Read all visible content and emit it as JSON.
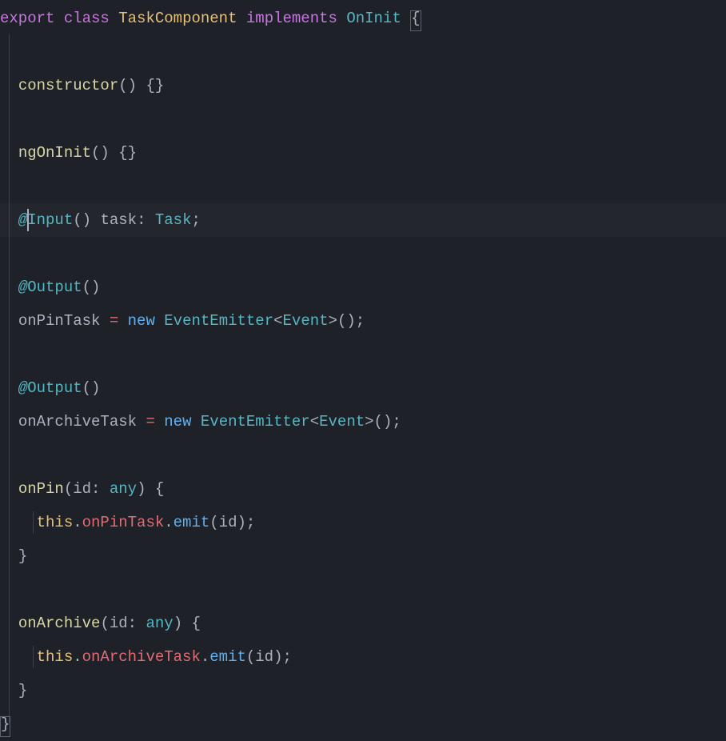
{
  "code": {
    "l1": {
      "export": "export",
      "class": "class",
      "className": "TaskComponent",
      "implements": "implements",
      "iface": "OnInit",
      "brace": "{"
    },
    "l3": {
      "ctor": "constructor",
      "parens": "()",
      "braces": "{}"
    },
    "l5": {
      "name": "ngOnInit",
      "parens": "()",
      "braces": "{}"
    },
    "l7": {
      "at": "@",
      "deco": "Input",
      "parens": "()",
      "prop": "task",
      "colon": ":",
      "type": "Task",
      "semi": ";"
    },
    "l9": {
      "at": "@",
      "deco": "Output",
      "parens": "()"
    },
    "l10": {
      "prop": "onPinTask",
      "eq": "=",
      "new": "new",
      "ctor": "EventEmitter",
      "lt": "<",
      "gen": "Event",
      "gt": ">",
      "parens": "()",
      "semi": ";"
    },
    "l12": {
      "at": "@",
      "deco": "Output",
      "parens": "()"
    },
    "l13": {
      "prop": "onArchiveTask",
      "eq": "=",
      "new": "new",
      "ctor": "EventEmitter",
      "lt": "<",
      "gen": "Event",
      "gt": ">",
      "parens": "()",
      "semi": ";"
    },
    "l15": {
      "name": "onPin",
      "lp": "(",
      "param": "id",
      "colon": ":",
      "type": "any",
      "rp": ")",
      "brace": "{"
    },
    "l16": {
      "this": "this",
      "dot1": ".",
      "prop": "onPinTask",
      "dot2": ".",
      "method": "emit",
      "lp": "(",
      "arg": "id",
      "rp": ")",
      "semi": ";"
    },
    "l17": {
      "brace": "}"
    },
    "l19": {
      "name": "onArchive",
      "lp": "(",
      "param": "id",
      "colon": ":",
      "type": "any",
      "rp": ")",
      "brace": "{"
    },
    "l20": {
      "this": "this",
      "dot1": ".",
      "prop": "onArchiveTask",
      "dot2": ".",
      "method": "emit",
      "lp": "(",
      "arg": "id",
      "rp": ")",
      "semi": ";"
    },
    "l21": {
      "brace": "}"
    },
    "l22": {
      "brace": "}"
    }
  }
}
